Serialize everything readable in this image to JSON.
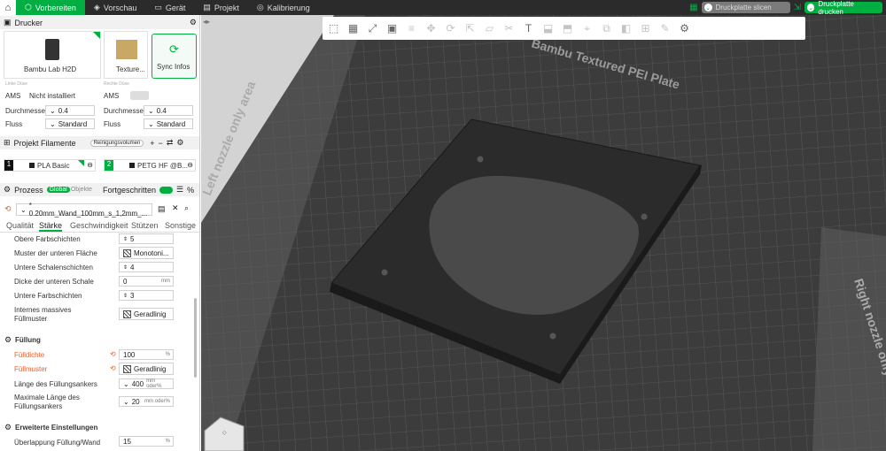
{
  "tabs": [
    {
      "label": "Vorbereiten",
      "icon": "cube-icon"
    },
    {
      "label": "Vorschau",
      "icon": "layers-icon"
    },
    {
      "label": "Gerät",
      "icon": "monitor-icon"
    },
    {
      "label": "Projekt",
      "icon": "folder-icon"
    },
    {
      "label": "Kalibrierung",
      "icon": "target-icon"
    }
  ],
  "actions": {
    "slice": "Druckplatte slicen",
    "print": "Druckplatte drucken"
  },
  "printer": {
    "section": "Drucker",
    "name": "Bambu Lab H2D",
    "plate": "Texture...",
    "sync": "Sync Infos"
  },
  "nozzles": {
    "left_title": "Linke Düse",
    "right_title": "Rechte Düse",
    "ams": "AMS",
    "ams_left": "Nicht installiert",
    "diameter_label": "Durchmesser",
    "diameter_left": "0.4",
    "diameter_right": "0.4",
    "flow_label": "Fluss",
    "flow_left": "Standard",
    "flow_right": "Standard"
  },
  "filaments": {
    "section": "Projekt Filamente",
    "purge": "Reinigungsvolumen",
    "items": [
      {
        "num": "1",
        "name": "PLA Basic"
      },
      {
        "num": "2",
        "name": "PETG HF @B..."
      }
    ]
  },
  "process": {
    "section": "Prozess",
    "global": "Global",
    "objects": "Objekte",
    "advanced": "Fortgeschritten",
    "preset": "* 0.20mm_Wand_100mm_s_1,2mm_...",
    "tabs": [
      "Qualität",
      "Stärke",
      "Geschwindigkeit",
      "Stützen",
      "Sonstige"
    ]
  },
  "settings": [
    {
      "label": "Obere Farbschichten",
      "value": "5",
      "unit": ""
    },
    {
      "label": "Muster der unteren Fläche",
      "value": "Monotoni...",
      "unit": ""
    },
    {
      "label": "Untere Schalenschichten",
      "value": "4",
      "unit": ""
    },
    {
      "label": "Dicke der unteren Schale",
      "value": "0",
      "unit": "mm"
    },
    {
      "label": "Untere Farbschichten",
      "value": "3",
      "unit": ""
    },
    {
      "label": "Internes massives Füllmuster",
      "value": "Geradlinig",
      "unit": ""
    }
  ],
  "fill": {
    "header": "Füllung",
    "density_label": "Fülldichte",
    "density": "100",
    "density_unit": "%",
    "pattern_label": "Füllmuster",
    "pattern": "Geradlinig",
    "anchor_label": "Länge des Füllungsankers",
    "anchor": "400",
    "anchor_unit": "mm oder%",
    "maxanchor_label": "Maximale Länge des Füllungsankers",
    "maxanchor": "20",
    "maxanchor_unit": "mm oder%"
  },
  "advanced": {
    "header": "Erweiterte Einstellungen",
    "overlap_label": "Überlappung Füllung/Wand",
    "overlap": "15",
    "overlap_unit": "%"
  },
  "plate": {
    "title": "Bambu Textured PEI Plate",
    "left_zone": "Left nozzle only area",
    "right_zone": "Right nozzle only area"
  },
  "colors": {
    "accent": "#00ae42",
    "modified": "#e8602c"
  }
}
